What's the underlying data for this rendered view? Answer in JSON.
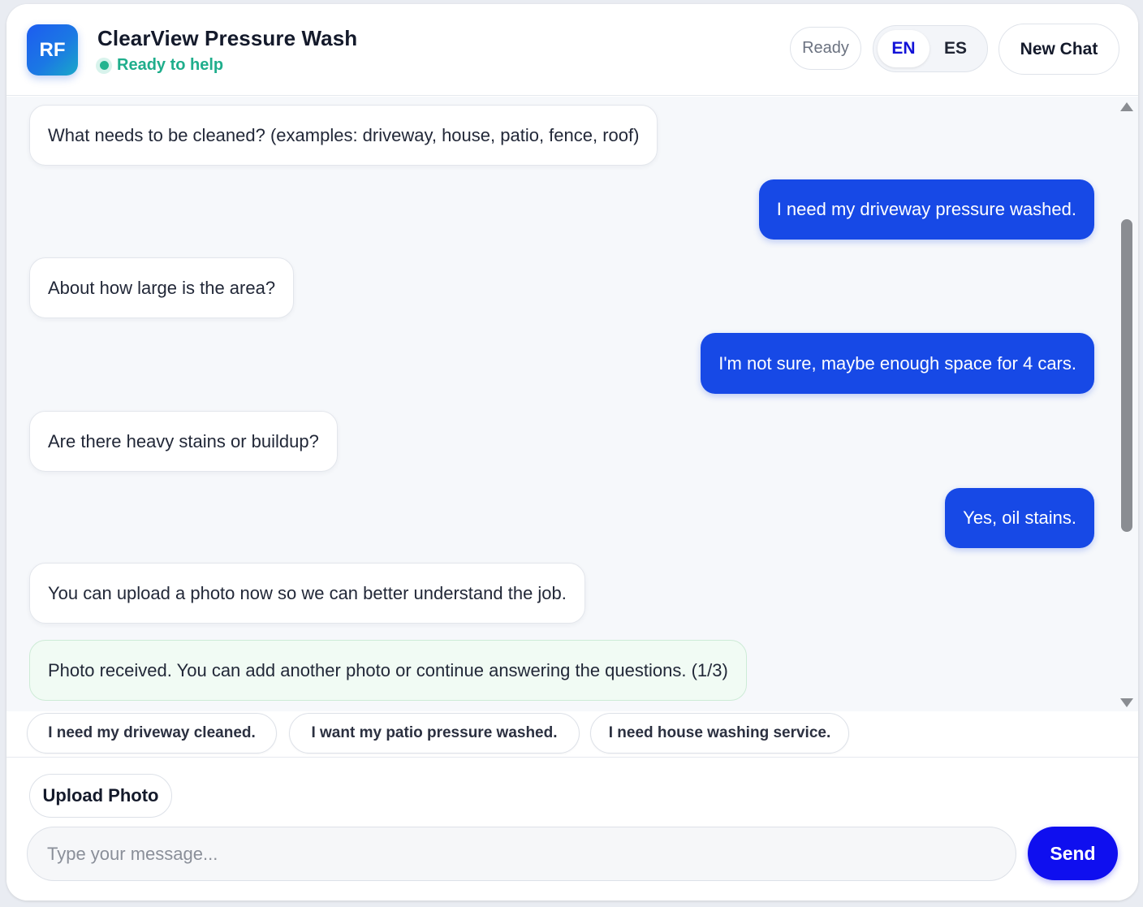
{
  "header": {
    "avatar_initials": "RF",
    "title": "ClearView Pressure Wash",
    "status": "Ready to help",
    "ready_badge": "Ready",
    "languages": [
      "EN",
      "ES"
    ],
    "active_language": "EN",
    "new_chat_label": "New Chat"
  },
  "messages": [
    {
      "role": "bot",
      "text": "What needs to be cleaned? (examples: driveway, house, patio, fence, roof)"
    },
    {
      "role": "user",
      "text": "I need my driveway pressure washed."
    },
    {
      "role": "bot",
      "text": "About how large is the area?"
    },
    {
      "role": "user",
      "text": "I'm not sure, maybe enough space for 4 cars."
    },
    {
      "role": "bot",
      "text": "Are there heavy stains or buildup?"
    },
    {
      "role": "user",
      "text": "Yes, oil stains."
    },
    {
      "role": "bot",
      "text": "You can upload a photo now so we can better understand the job."
    },
    {
      "role": "notice",
      "text": "Photo received. You can add another photo or continue answering the questions. (1/3)"
    }
  ],
  "suggestions": [
    "I need my driveway cleaned.",
    "I want my patio pressure washed.",
    "I need house washing service."
  ],
  "footer": {
    "upload_label": "Upload Photo",
    "input_placeholder": "Type your message...",
    "input_value": "",
    "send_label": "Send"
  },
  "colors": {
    "accent": "#1749e6",
    "send": "#0f0fef",
    "status_green": "#1fae8c"
  }
}
